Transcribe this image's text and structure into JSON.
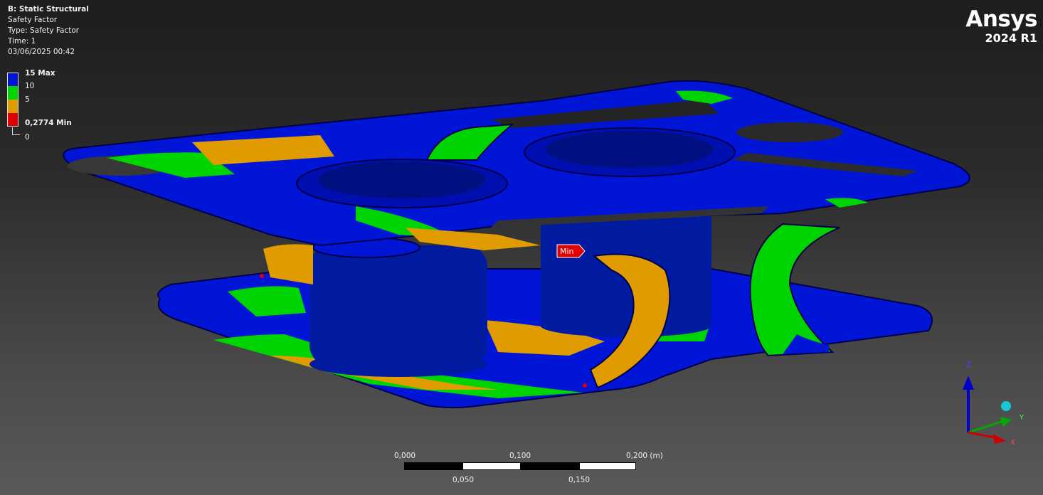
{
  "info": {
    "title": "B: Static Structural",
    "result": "Safety Factor",
    "type": "Type: Safety Factor",
    "time": "Time: 1",
    "date": "03/06/2025 00:42"
  },
  "legend": {
    "max_label": "15 Max",
    "l10": "10",
    "l5": "5",
    "min_label": "0,2774 Min",
    "zero": "0",
    "colors": {
      "blue": "#0015d6",
      "green": "#00d400",
      "orange": "#e09b00",
      "red": "#e00000"
    }
  },
  "brand": {
    "name": "Ansys",
    "version": "2024 R1"
  },
  "probe": {
    "min_tag": "Min"
  },
  "scale_bar": {
    "top_labels": [
      "0,000",
      "0,100",
      "0,200 (m)"
    ],
    "bottom_labels": [
      "0,050",
      "0,150"
    ]
  },
  "triad": {
    "z": "Z",
    "y": "Y",
    "x": "X"
  }
}
